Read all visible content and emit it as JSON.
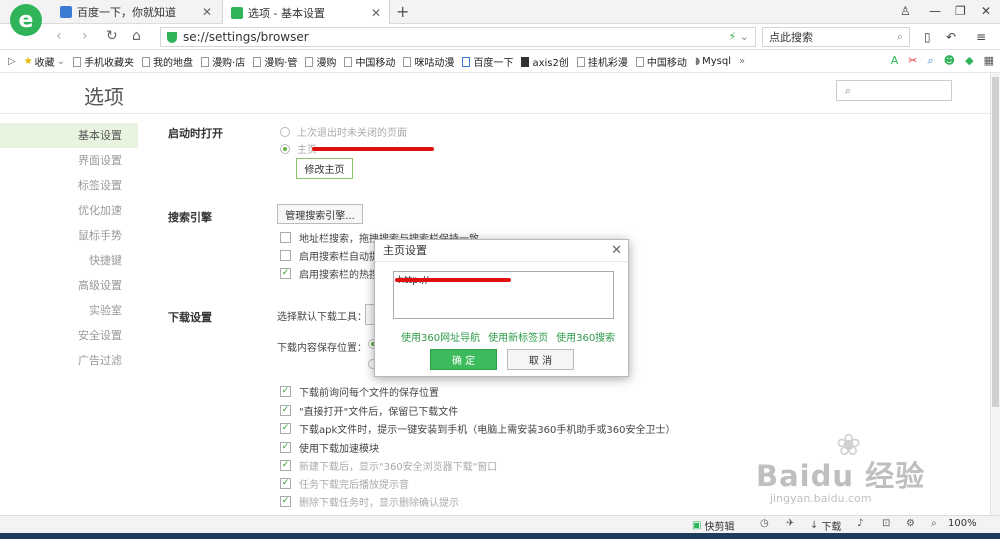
{
  "colors": {
    "accent": "#2fb45a",
    "sidebar_active_bg": "#e9f4e0",
    "link": "#2e9a4a",
    "ok_button": "#3cbb5c"
  },
  "browser": {
    "tabs": [
      {
        "label": "百度一下，你就知道"
      },
      {
        "label": "选项 - 基本设置"
      }
    ],
    "url": "se://settings/browser",
    "search_text": "点此搜索",
    "bookmarks": [
      "收藏",
      "手机收藏夹",
      "我的地盘",
      "漫购·店",
      "漫购·管",
      "漫购",
      "中国移动",
      "咪咕动漫",
      "百度一下",
      "axis2创",
      "挂机彩漫",
      "中国移动",
      "Mysql"
    ],
    "more_bookmarks": "»"
  },
  "page": {
    "title": "选项",
    "sidebar": [
      {
        "label": "基本设置"
      },
      {
        "label": "界面设置"
      },
      {
        "label": "标签设置"
      },
      {
        "label": "优化加速"
      },
      {
        "label": "鼠标手势"
      },
      {
        "label": "快捷键"
      },
      {
        "label": "高级设置"
      },
      {
        "label": "实验室"
      },
      {
        "label": "安全设置"
      },
      {
        "label": "广告过滤"
      }
    ],
    "startup": {
      "heading": "启动时打开",
      "opt_last": "上次退出时未关闭的页面",
      "opt_home": "主页",
      "modify_home": "修改主页"
    },
    "search_engine": {
      "heading": "搜索引擎",
      "manage": "管理搜索引擎...",
      "opt1": "地址栏搜索，拖拽搜索与搜索栏保持一致",
      "opt2": "启用搜索栏自动提",
      "opt3": "启用搜索栏的热搜"
    },
    "download": {
      "heading": "下载设置",
      "tool_label": "选择默认下载工具：",
      "path_label": "下载内容保存位置：",
      "items": [
        "下载前询问每个文件的保存位置",
        "\"直接打开\"文件后，保留已下载文件",
        "下载apk文件时，提示一键安装到手机（电脑上需安装360手机助手或360安全卫士）",
        "使用下载加速模块",
        "新建下载后，显示\"360安全浏览器下载\"窗口",
        "任务下载完后播放提示音",
        "删除下载任务时，显示删除确认提示"
      ]
    }
  },
  "dialog": {
    "title": "主页设置",
    "close": "✕",
    "value": "http://",
    "links": [
      "使用360网址导航",
      "使用新标签页",
      "使用360搜索"
    ],
    "ok": "确 定",
    "cancel": "取 消"
  },
  "statusbar": {
    "quick_clip": "快剪辑",
    "download": "下载",
    "zoom": "100%"
  },
  "watermark": {
    "main": "Baidu 经验",
    "sub": "jingyan.baidu.com"
  }
}
